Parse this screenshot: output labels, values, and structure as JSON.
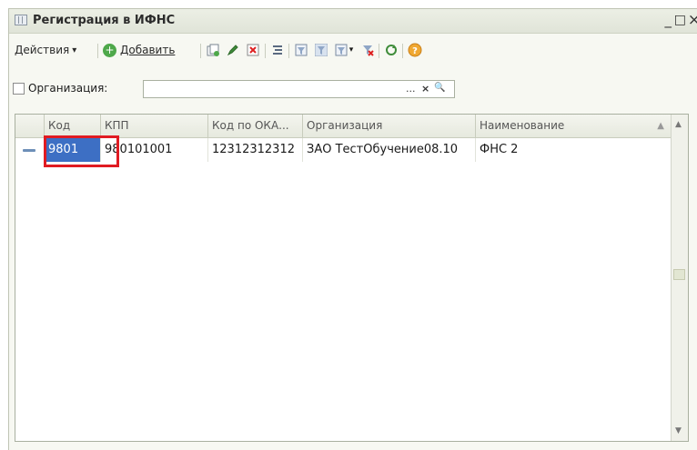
{
  "window": {
    "title": "Регистрация в ИФНС",
    "minimize": "_",
    "maximize": "□",
    "close": "×"
  },
  "toolbar": {
    "actions_label": "Действия",
    "actions_arrow": "▾",
    "add_label": "Добавить",
    "filter_arrow": "▾",
    "icons": [
      "copy-icon",
      "edit-icon",
      "delete-icon",
      "hierarchy-icon",
      "filter-settings-icon",
      "filter-by-value-icon",
      "filter-icon",
      "clear-filter-icon",
      "refresh-icon",
      "help-icon"
    ]
  },
  "filter": {
    "label": "Организация:",
    "value": "",
    "select_btn": "...",
    "clear_btn": "×",
    "search_btn": "🔍"
  },
  "table": {
    "columns": [
      "Код",
      "КПП",
      "Код по ОКА...",
      "Организация",
      "Наименование"
    ],
    "rows": [
      {
        "code": "9801",
        "kpp": "980101001",
        "okato": "12312312312",
        "organization": "ЗАО ТестОбучение08.10",
        "name": "ФНС 2"
      }
    ]
  },
  "colors": {
    "selection": "#3d6fc4",
    "highlight_frame": "#e01b22"
  }
}
